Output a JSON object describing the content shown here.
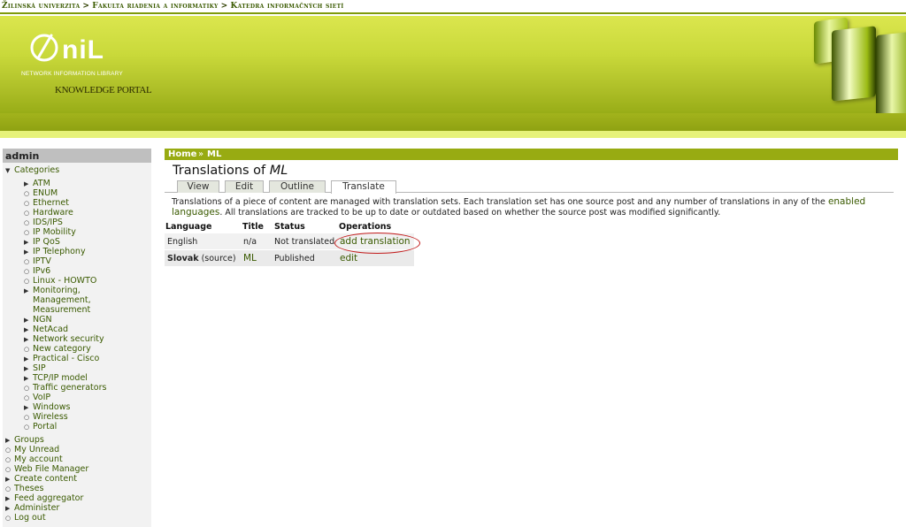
{
  "breadcrumb_top": {
    "items": [
      "Žilinská univerzita",
      "Fakulta riadenia a informatiky",
      "Katedra informačných sietí"
    ],
    "separator": ">"
  },
  "header": {
    "logo_word": "niL",
    "logo_subtitle": "NETWORK INFORMATION LIBRARY",
    "logo_portal": "KNOWLEDGE PORTAL"
  },
  "sidebar": {
    "title": "admin",
    "categories_label": "Categories",
    "categories": [
      {
        "label": "ATM",
        "type": "collapsed"
      },
      {
        "label": "ENUM",
        "type": "leaf"
      },
      {
        "label": "Ethernet",
        "type": "leaf"
      },
      {
        "label": "Hardware",
        "type": "leaf"
      },
      {
        "label": "IDS/IPS",
        "type": "leaf"
      },
      {
        "label": "IP Mobility",
        "type": "leaf"
      },
      {
        "label": "IP QoS",
        "type": "collapsed"
      },
      {
        "label": "IP Telephony",
        "type": "collapsed"
      },
      {
        "label": "IPTV",
        "type": "leaf"
      },
      {
        "label": "IPv6",
        "type": "leaf"
      },
      {
        "label": "Linux - HOWTO",
        "type": "leaf"
      },
      {
        "label": "Monitoring,",
        "type": "collapsed"
      },
      {
        "label": "Management,",
        "type": "cont"
      },
      {
        "label": "Measurement",
        "type": "cont"
      },
      {
        "label": "NGN",
        "type": "collapsed"
      },
      {
        "label": "NetAcad",
        "type": "collapsed"
      },
      {
        "label": "Network security",
        "type": "collapsed"
      },
      {
        "label": "New category",
        "type": "leaf"
      },
      {
        "label": "Practical - Cisco",
        "type": "collapsed"
      },
      {
        "label": "SIP",
        "type": "collapsed"
      },
      {
        "label": "TCP/IP model",
        "type": "collapsed"
      },
      {
        "label": "Traffic generators",
        "type": "leaf"
      },
      {
        "label": "VoIP",
        "type": "leaf"
      },
      {
        "label": "Windows",
        "type": "collapsed"
      },
      {
        "label": "Wireless",
        "type": "leaf"
      },
      {
        "label": "Portal",
        "type": "leaf"
      }
    ],
    "menu": [
      {
        "label": "Groups",
        "type": "collapsed"
      },
      {
        "label": "My Unread",
        "type": "leaf"
      },
      {
        "label": "My account",
        "type": "leaf"
      },
      {
        "label": "Web File Manager",
        "type": "leaf"
      },
      {
        "label": "Create content",
        "type": "collapsed"
      },
      {
        "label": "Theses",
        "type": "leaf"
      },
      {
        "label": "Feed aggregator",
        "type": "collapsed"
      },
      {
        "label": "Administer",
        "type": "collapsed"
      },
      {
        "label": "Log out",
        "type": "leaf"
      }
    ]
  },
  "content": {
    "crumb_home": "Home",
    "crumb_sep": "»",
    "crumb_current": "ML",
    "title_prefix": "Translations of ",
    "title_node": "ML",
    "tabs": [
      {
        "label": "View",
        "active": false
      },
      {
        "label": "Edit",
        "active": false
      },
      {
        "label": "Outline",
        "active": false
      },
      {
        "label": "Translate",
        "active": true
      }
    ],
    "intro_part1": "Translations of a piece of content are managed with translation sets. Each translation set has one source post and any number of translations in any of the",
    "intro_link": "enabled languages",
    "intro_part2": ". All translations are tracked to be up to date or outdated based on whether the source post was modified significantly.",
    "table": {
      "headers": [
        "Language",
        "Title",
        "Status",
        "Operations"
      ],
      "rows": [
        {
          "language": "English",
          "source_suffix": "",
          "title": "n/a",
          "status": "Not translated",
          "operation": "add translation"
        },
        {
          "language": "Slovak",
          "source_suffix": "(source)",
          "title": "ML",
          "status": "Published",
          "operation": "edit"
        }
      ]
    }
  },
  "colors": {
    "accent_green": "#98ab12",
    "link_green": "#3a5a00",
    "highlight_red": "#c21b1b"
  }
}
